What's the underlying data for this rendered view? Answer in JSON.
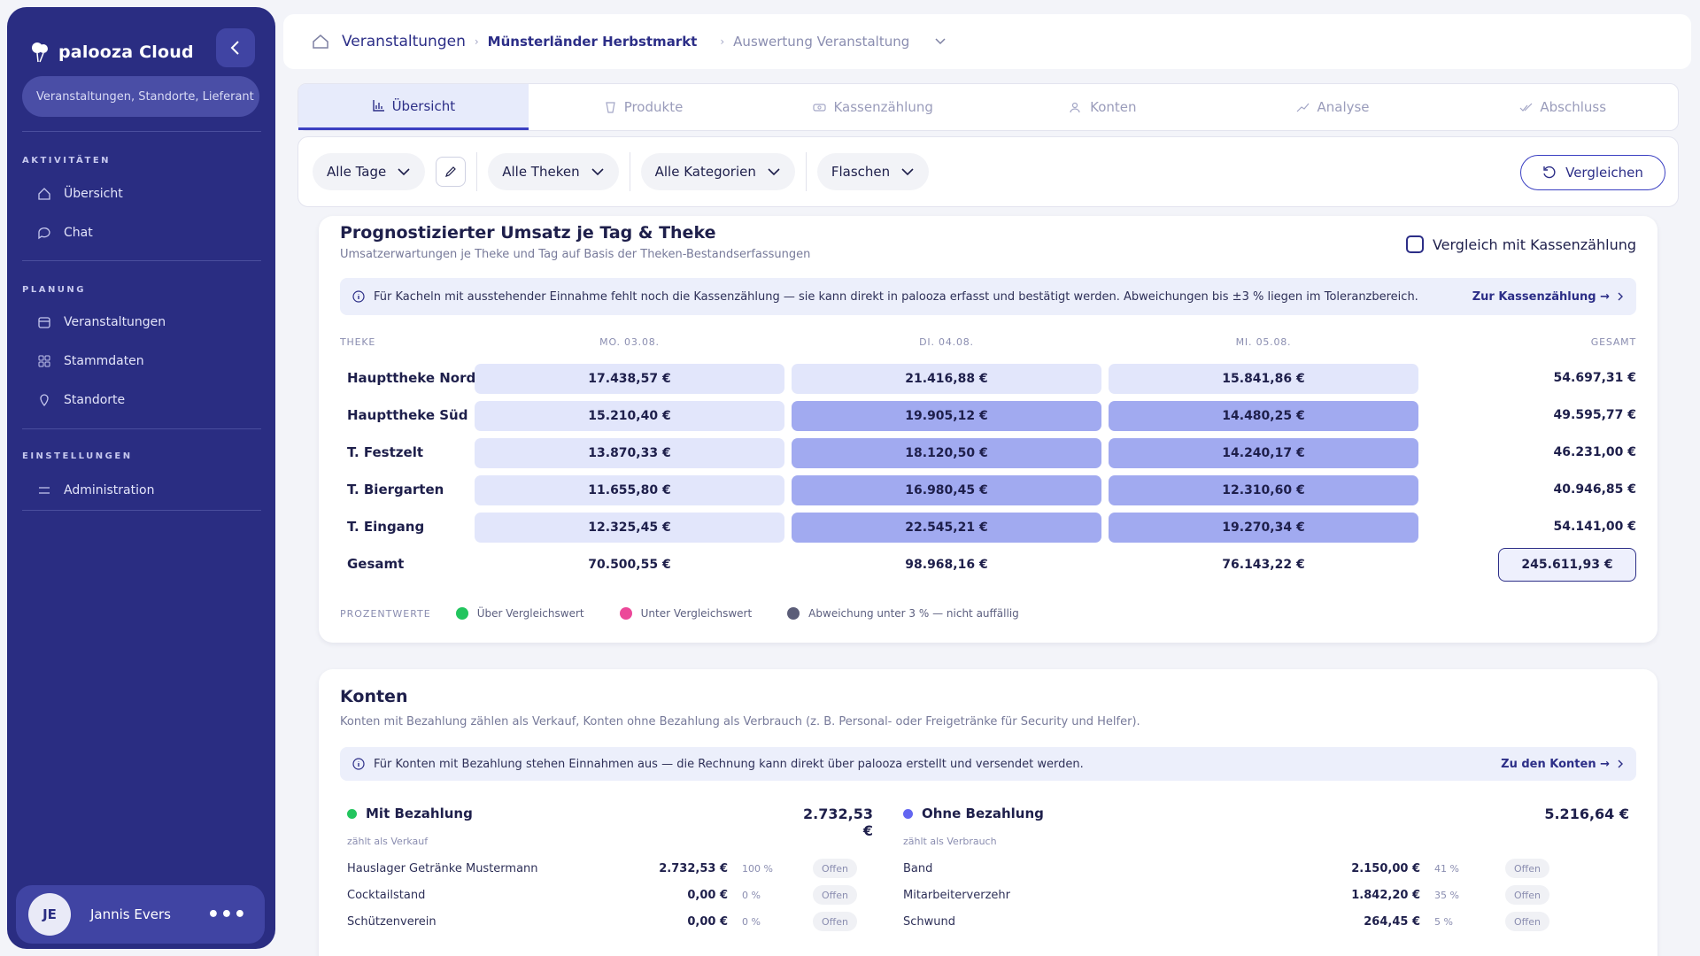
{
  "sidebar": {
    "brand": "palooza Cloud",
    "search_placeholder": "Veranstaltungen, Standorte, Lieferant",
    "sections": [
      {
        "title": "AKTIVITÄTEN",
        "items": [
          "Übersicht",
          "Chat"
        ]
      },
      {
        "title": "PLANUNG",
        "items": [
          "Veranstaltungen",
          "Stammdaten",
          "Standorte"
        ]
      },
      {
        "title": "EINSTELLUNGEN",
        "items": [
          "Administration"
        ]
      }
    ],
    "user": {
      "initials": "JE",
      "name": "Jannis Evers",
      "more": "•••"
    }
  },
  "breadcrumb": {
    "level1": "Veranstaltungen",
    "level2": "Münsterländer Herbstmarkt",
    "level3": "Auswertung Veranstaltung"
  },
  "tabs": [
    {
      "label": "Übersicht",
      "icon": "bar-chart-icon",
      "active": true
    },
    {
      "label": "Produkte",
      "icon": "products-icon",
      "active": false
    },
    {
      "label": "Kassenzählung",
      "icon": "cash-icon",
      "active": false
    },
    {
      "label": "Konten",
      "icon": "accounts-icon",
      "active": false
    },
    {
      "label": "Analyse",
      "icon": "trend-icon",
      "active": false
    },
    {
      "label": "Abschluss",
      "icon": "check-icon",
      "active": false
    }
  ],
  "filters": {
    "days": "Alle Tage",
    "counters": "Alle Theken",
    "categories": "Alle Kategorien",
    "unit": "Flaschen",
    "compare": "Vergleichen"
  },
  "forecast": {
    "title": "Prognostizierter Umsatz je Tag & Theke",
    "subtitle": "Umsatzerwartungen je Theke und Tag auf Basis der Theken-Bestandserfassungen",
    "compare_toggle": "Vergleich mit Kassenzählung",
    "info": "Für Kacheln mit ausstehender Einnahme fehlt noch die Kassenzählung — sie kann direkt in palooza erfasst und bestätigt werden. Abweichungen bis ±3 % liegen im Toleranzbereich.",
    "info_link": "Zur Kassenzählung →",
    "headers": {
      "counter": "THEKE",
      "day1": "MO. 03.08.",
      "day2": "DI. 04.08.",
      "day3": "MI. 05.08.",
      "total": "GESAMT"
    },
    "rows": [
      {
        "name": "Haupttheke Nord",
        "d1": "17.438,57 €",
        "d2": "21.416,88 €",
        "d3": "15.841,86 €",
        "total": "54.697,31 €",
        "s1": "light",
        "s2": "light",
        "s3": "light"
      },
      {
        "name": "Haupttheke Süd",
        "d1": "15.210,40 €",
        "d2": "19.905,12 €",
        "d3": "14.480,25 €",
        "total": "49.595,77 €",
        "s1": "light",
        "s2": "strong",
        "s3": "strong"
      },
      {
        "name": "T. Festzelt",
        "d1": "13.870,33 €",
        "d2": "18.120,50 €",
        "d3": "14.240,17 €",
        "total": "46.231,00 €",
        "s1": "light",
        "s2": "strong",
        "s3": "strong"
      },
      {
        "name": "T. Biergarten",
        "d1": "11.655,80 €",
        "d2": "16.980,45 €",
        "d3": "12.310,60 €",
        "total": "40.946,85 €",
        "s1": "light",
        "s2": "strong",
        "s3": "strong"
      },
      {
        "name": "T. Eingang",
        "d1": "12.325,45 €",
        "d2": "22.545,21 €",
        "d3": "19.270,34 €",
        "total": "54.141,00 €",
        "s1": "light",
        "s2": "strong",
        "s3": "strong"
      }
    ],
    "sum": {
      "name": "Gesamt",
      "d1": "70.500,55 €",
      "d2": "98.968,16 €",
      "d3": "76.143,22 €",
      "total": "245.611,93 €"
    },
    "legend": {
      "title": "PROZENTWERTE",
      "items": [
        {
          "label": "Über Vergleichswert",
          "color": "#22c55e"
        },
        {
          "label": "Unter Vergleichswert",
          "color": "#ec4899"
        },
        {
          "label": "Abweichung unter 3 % — nicht auffällig",
          "color": "#5b5d78"
        }
      ]
    }
  },
  "accounts": {
    "title": "Konten",
    "subtitle": "Konten mit Bezahlung zählen als Verkauf, Konten ohne Bezahlung als Verbrauch (z. B. Personal- oder Freigetränke für Security und Helfer).",
    "info": "Für Konten mit Bezahlung stehen Einnahmen aus — die Rechnung kann direkt über palooza erstellt und versendet werden.",
    "info_link": "Zu den Konten →",
    "paid": {
      "title": "Mit Bezahlung",
      "amount": "2.732,53 €",
      "note": "zählt als Verkauf",
      "color": "#22c55e",
      "rows": [
        {
          "name": "Hauslager Getränke Mustermann",
          "value": "2.732,53 €",
          "pct": "100 %",
          "status": "Offen"
        },
        {
          "name": "Cocktailstand",
          "value": "0,00 €",
          "pct": "0 %",
          "status": "Offen"
        },
        {
          "name": "Schützenverein",
          "value": "0,00 €",
          "pct": "0 %",
          "status": "Offen"
        }
      ]
    },
    "unpaid": {
      "title": "Ohne Bezahlung",
      "amount": "5.216,64 €",
      "note": "zählt als Verbrauch",
      "color": "#6366f1",
      "rows": [
        {
          "name": "Band",
          "value": "2.150,00 €",
          "pct": "41 %",
          "status": "Offen"
        },
        {
          "name": "Mitarbeiterverzehr",
          "value": "1.842,20 €",
          "pct": "35 %",
          "status": "Offen"
        },
        {
          "name": "Schwund",
          "value": "264,45 €",
          "pct": "5 %",
          "status": "Offen"
        }
      ]
    }
  }
}
